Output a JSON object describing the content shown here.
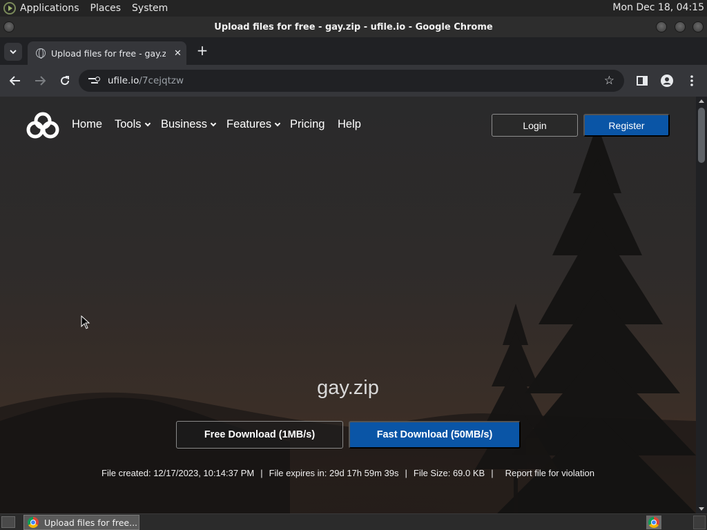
{
  "desktop": {
    "menus": [
      "Applications",
      "Places",
      "System"
    ],
    "clock": "Mon Dec 18, 04:15"
  },
  "window": {
    "title": "Upload files for free - gay.zip - ufile.io - Google Chrome"
  },
  "browser": {
    "tab_title": "Upload files for free - gay.zip - ufile.io",
    "url_host": "ufile.io",
    "url_path": "/7cejqtzw"
  },
  "site": {
    "nav": {
      "home": "Home",
      "tools": "Tools",
      "business": "Business",
      "features": "Features",
      "pricing": "Pricing",
      "help": "Help"
    },
    "login_label": "Login",
    "register_label": "Register",
    "file_name": "gay.zip",
    "free_download_label": "Free Download (1MB/s)",
    "fast_download_label": "Fast Download (50MB/s)",
    "meta": {
      "created": "File created: 12/17/2023, 10:14:37 PM",
      "expires": "File expires in: 29d 17h 59m 39s",
      "size": "File Size: 69.0 KB",
      "report": "Report file for violation"
    },
    "accent_color": "#0a55a6"
  },
  "taskbar": {
    "task_label": "Upload files for free..."
  },
  "icons": [
    "app-menu-logo-icon",
    "chevron-down-icon",
    "globe-icon",
    "close-icon",
    "plus-icon",
    "back-arrow-icon",
    "forward-arrow-icon",
    "reload-icon",
    "site-info-icon",
    "star-icon",
    "side-panel-icon",
    "profile-icon",
    "kebab-menu-icon",
    "ufile-logo-icon",
    "chrome-icon",
    "mouse-cursor-icon"
  ]
}
